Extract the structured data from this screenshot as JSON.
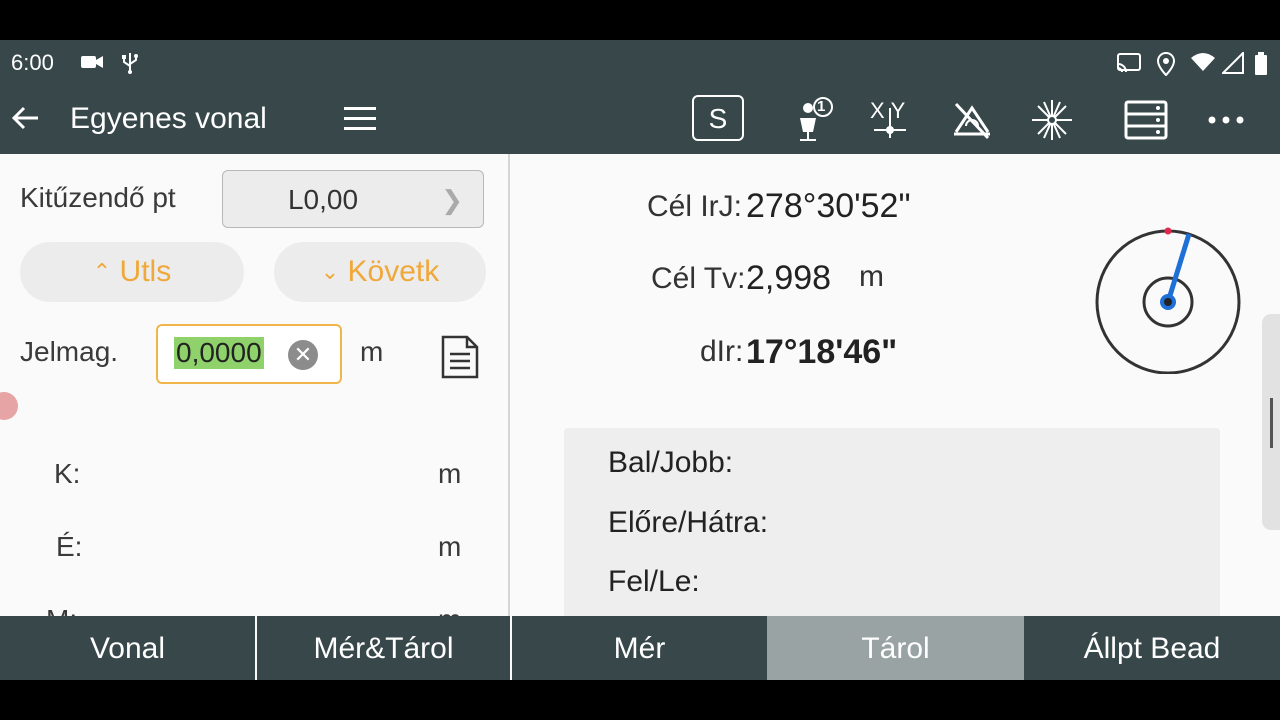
{
  "status_bar": {
    "time": "6:00"
  },
  "app_bar": {
    "title": "Egyenes vonal",
    "tools": {
      "s_label": "S",
      "xy_label": "XY",
      "person_badge": "1"
    }
  },
  "left_panel": {
    "stakeout_point": {
      "label": "Kitűzendő pt",
      "value": "L0,00"
    },
    "prev_button": "Utls",
    "next_button": "Követk",
    "target_height": {
      "label": "Jelmag.",
      "value": "0,0000",
      "unit": "m"
    },
    "coords": [
      {
        "label": "K:",
        "unit": "m"
      },
      {
        "label": "É:",
        "unit": "m"
      },
      {
        "label": "M:",
        "unit": "m"
      }
    ]
  },
  "right_panel": {
    "target_azimuth": {
      "label": "Cél IrJ:",
      "value": "278°30'52\""
    },
    "target_distance": {
      "label": "Cél Tv:",
      "value": "2,998",
      "unit": "m"
    },
    "delta_direction": {
      "label": "dIr:",
      "value": "17°18'46\""
    },
    "offsets": {
      "left_right": "Bal/Jobb:",
      "forward_back": "Előre/Hátra:",
      "up_down": "Fel/Le:"
    },
    "page_indicator": {
      "pages": 2,
      "active": 1
    }
  },
  "bottom_bar": {
    "buttons": [
      "Vonal",
      "Mér&Tárol",
      "Mér",
      "Tárol",
      "Állpt Bead"
    ],
    "active_index": 3
  },
  "colors": {
    "bar_bg": "#37474a",
    "accent": "#f0a83a",
    "highlight": "#8fd16a",
    "active_tab": "#9aa3a3",
    "compass_needle": "#1e6fd6"
  }
}
